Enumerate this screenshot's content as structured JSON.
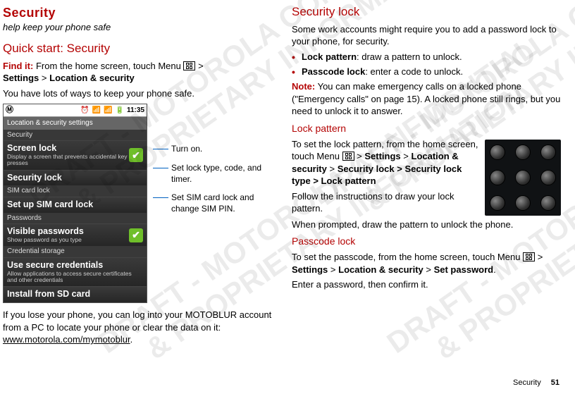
{
  "watermarks": {
    "text": "DRAFT - MOTOROLA CONFIDENTIAL\n& PROPRIETARY INFORMATION"
  },
  "left": {
    "title": "Security",
    "subtitle": "help keep your phone safe",
    "quick_start_heading": "Quick start: Security",
    "find_it_label": "Find it:",
    "find_it_text_a": " From the home screen, touch Menu ",
    "bc_settings": "Settings",
    "bc_loc_sec": "Location & security",
    "intro": "You have lots of ways to keep your phone safe.",
    "phone": {
      "time": "11:35",
      "title": "Location & security settings",
      "g_security": "Security",
      "r_screen_lock_t": "Screen lock",
      "r_screen_lock_d": "Display a screen that prevents accidental key presses",
      "r_security_lock_t": "Security lock",
      "g_sim": "SIM card lock",
      "r_sim_t": "Set up SIM card lock",
      "g_passwords": "Passwords",
      "r_visible_t": "Visible passwords",
      "r_visible_d": "Show password as you type",
      "g_cred": "Credential storage",
      "r_cred_t": "Use secure credentials",
      "r_cred_d": "Allow applications to access secure certificates and other credentials",
      "r_install_t": "Install from SD card"
    },
    "callouts": {
      "c1": "Turn on.",
      "c2": "Set lock type, code, and timer.",
      "c3": "Set SIM card lock and change SIM PIN."
    },
    "para2a": "If you lose your phone, you can log into your MOTOBLUR account from a PC to locate your phone or clear the data on it:",
    "para2b": "www.motorola.com/mymotoblur",
    "para2c": "."
  },
  "right": {
    "heading": "Security lock",
    "p1": "Some work accounts might require you to add a password lock to your phone, for security.",
    "b1_lbl": "Lock pattern",
    "b1_txt": ": draw a pattern to unlock.",
    "b2_lbl": "Passcode lock",
    "b2_txt": ": enter a code to unlock.",
    "note_lbl": "Note:",
    "note_txt": " You can make emergency calls on a locked phone (\"Emergency calls\" on page 15). A locked phone still rings, but you need to unlock it to answer.",
    "lp_heading": "Lock pattern",
    "lp_p1a": "To set the lock pattern, from the home screen, touch Menu ",
    "lp_bc1": "Settings",
    "lp_bc2": "Location & security",
    "lp_bc3": "Security lock > Security lock type > Lock pattern",
    "lp_p2": "Follow the instructions to draw your lock pattern.",
    "lp_p3": "When prompted, draw the pattern to unlock the phone.",
    "pc_heading": "Passcode lock",
    "pc_p1a": "To set the passcode, from the home screen, touch Menu ",
    "pc_bc1": "Settings",
    "pc_bc2": "Location & security",
    "pc_bc3": "Set password",
    "pc_p2": "Enter a password, then confirm it."
  },
  "footer": {
    "label": "Security",
    "page": "51"
  }
}
